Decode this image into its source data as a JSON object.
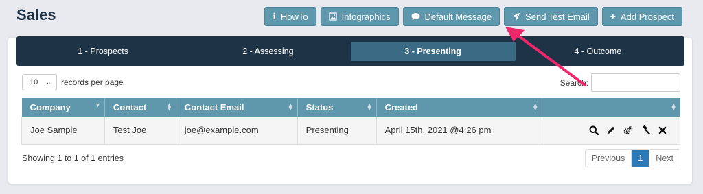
{
  "page": {
    "title": "Sales"
  },
  "toolbar": {
    "buttons": [
      {
        "label": "HowTo",
        "icon": "info-icon"
      },
      {
        "label": "Infographics",
        "icon": "image-icon"
      },
      {
        "label": "Default Message",
        "icon": "speech-bubble-icon"
      },
      {
        "label": "Send Test Email",
        "icon": "paper-plane-icon"
      },
      {
        "label": "Add Prospect",
        "icon": "plus-icon"
      }
    ],
    "color": "#5f97ac"
  },
  "tabs": [
    {
      "label": "1 - Prospects",
      "active": false
    },
    {
      "label": "2 - Assessing",
      "active": false
    },
    {
      "label": "3 - Presenting",
      "active": true
    },
    {
      "label": "4 - Outcome",
      "active": false
    }
  ],
  "length": {
    "value": "10",
    "label": "records per page"
  },
  "search": {
    "label": "Search:",
    "value": ""
  },
  "table": {
    "headers": [
      "Company",
      "Contact",
      "Contact Email",
      "Status",
      "Created",
      ""
    ],
    "rows": [
      {
        "company": "Joe Sample",
        "contact": "Test Joe",
        "email": "joe@example.com",
        "status": "Presenting",
        "created": "April 15th, 2021 @4:26 pm"
      }
    ],
    "row_actions": [
      "search-icon",
      "pencil-icon",
      "gears-icon",
      "gavel-icon",
      "close-icon"
    ]
  },
  "info": "Showing 1 to 1 of 1 entries",
  "pagination": {
    "previous": "Previous",
    "current": "1",
    "next": "Next"
  },
  "colors": {
    "header_bg": "#5f97ac",
    "tabs_bg": "#1e3446",
    "active_tab": "#3b6a85",
    "arrow": "#f0266b",
    "page_active": "#2a7ab8"
  }
}
